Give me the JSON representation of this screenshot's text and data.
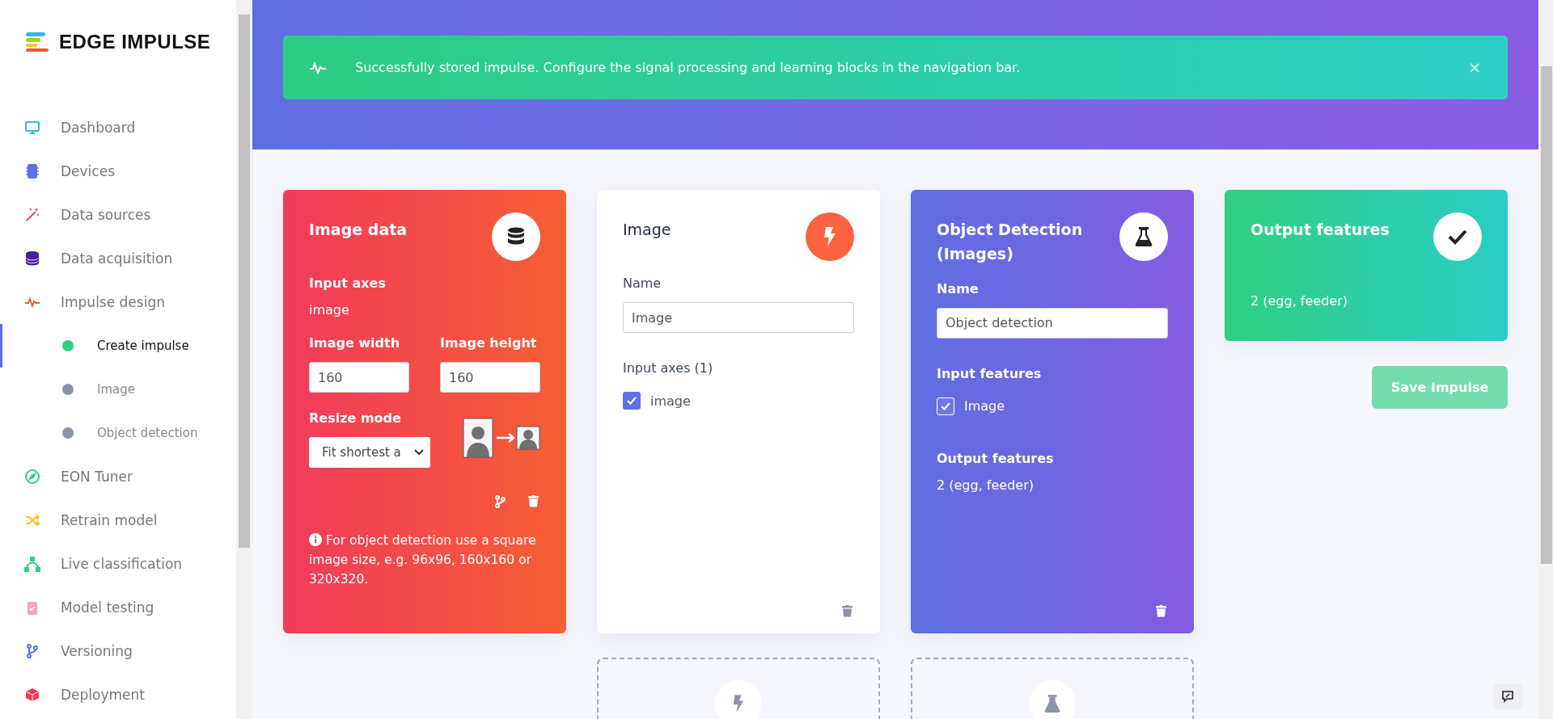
{
  "logo": {
    "text": "EDGE IMPULSE"
  },
  "nav": [
    {
      "label": "Dashboard",
      "kind": "monitor"
    },
    {
      "label": "Devices",
      "kind": "chip"
    },
    {
      "label": "Data sources",
      "kind": "wand"
    },
    {
      "label": "Data acquisition",
      "kind": "database"
    },
    {
      "label": "Impulse design",
      "kind": "pulse",
      "children": [
        {
          "label": "Create impulse",
          "selected": true
        },
        {
          "label": "Image",
          "selected": false
        },
        {
          "label": "Object detection",
          "selected": false
        }
      ]
    },
    {
      "label": "EON Tuner",
      "kind": "compass"
    },
    {
      "label": "Retrain model",
      "kind": "shuffle"
    },
    {
      "label": "Live classification",
      "kind": "bezier"
    },
    {
      "label": "Model testing",
      "kind": "clipboard"
    },
    {
      "label": "Versioning",
      "kind": "branch"
    },
    {
      "label": "Deployment",
      "kind": "cube"
    }
  ],
  "banner": {
    "message": "Successfully stored impulse. Configure the signal processing and learning blocks in the navigation bar."
  },
  "input_block": {
    "title": "Image data",
    "axes_label": "Input axes",
    "axes_value": "image",
    "width_label": "Image width",
    "width_value": "160",
    "height_label": "Image height",
    "height_value": "160",
    "resize_label": "Resize mode",
    "resize_value": "Fit shortest a",
    "note": "For object detection use a square image size, e.g. 96x96, 160x160 or 320x320."
  },
  "processing_block": {
    "title": "Image",
    "name_label": "Name",
    "name_value": "Image",
    "axes_label": "Input axes (1)",
    "axes": [
      {
        "label": "image",
        "checked": true
      }
    ]
  },
  "learning_block": {
    "title": "Object Detection (Images)",
    "name_label": "Name",
    "name_value": "Object detection",
    "input_label": "Input features",
    "inputs": [
      {
        "label": "Image",
        "checked": true
      }
    ],
    "output_label": "Output features",
    "output_value": "2 (egg, feeder)"
  },
  "output_block": {
    "title": "Output features",
    "value": "2 (egg, feeder)"
  },
  "save_button": {
    "label": "Save Impulse",
    "disabled": true
  },
  "add_slots": [
    {
      "kind": "processing"
    },
    {
      "kind": "learning"
    }
  ]
}
